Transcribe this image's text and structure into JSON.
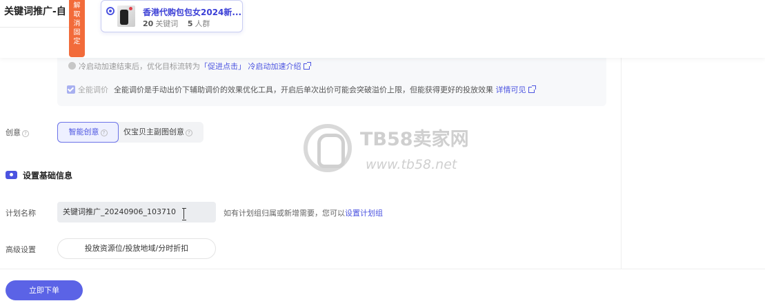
{
  "header": {
    "page_title": "关键词推广-自",
    "unpin_tag": [
      "解",
      "取",
      "消",
      "固",
      "定"
    ]
  },
  "product": {
    "title": "香港代购包包女2024新...",
    "keywords_count": "20",
    "keywords_label": "关键词",
    "crowd_count": "5",
    "crowd_label": "人群"
  },
  "cold_start": {
    "text": "冷启动加速结束后，优化目标流转为",
    "link1": "「促进点击」",
    "link2": "冷启动加速介绍"
  },
  "smart_bid": {
    "label": "全能调价",
    "text": "全能调价是手动出价下辅助调价的效果优化工具，开启后单次出价可能会突破溢价上限，但能获得更好的投放效果",
    "link": "详情可见"
  },
  "creative": {
    "label": "创意",
    "options": [
      "智能创意",
      "仅宝贝主副图创意"
    ],
    "selected": "智能创意"
  },
  "basic_section": {
    "title": "设置基础信息"
  },
  "plan_name": {
    "label": "计划名称",
    "value": "关键词推广_20240906_103710",
    "hint": "如有计划组归属或新增需要，您可以",
    "hint_link": "设置计划组"
  },
  "advanced": {
    "label": "高级设置",
    "button": "投放资源位/投放地域/分时折扣"
  },
  "footer": {
    "submit": "立即下单"
  },
  "watermark": {
    "title": "TB58卖家网",
    "url": "www.tb58.net"
  },
  "colors": {
    "accent": "#4b53e0",
    "unpin_tag": "#f26b3a",
    "submit": "#5b63e6"
  }
}
